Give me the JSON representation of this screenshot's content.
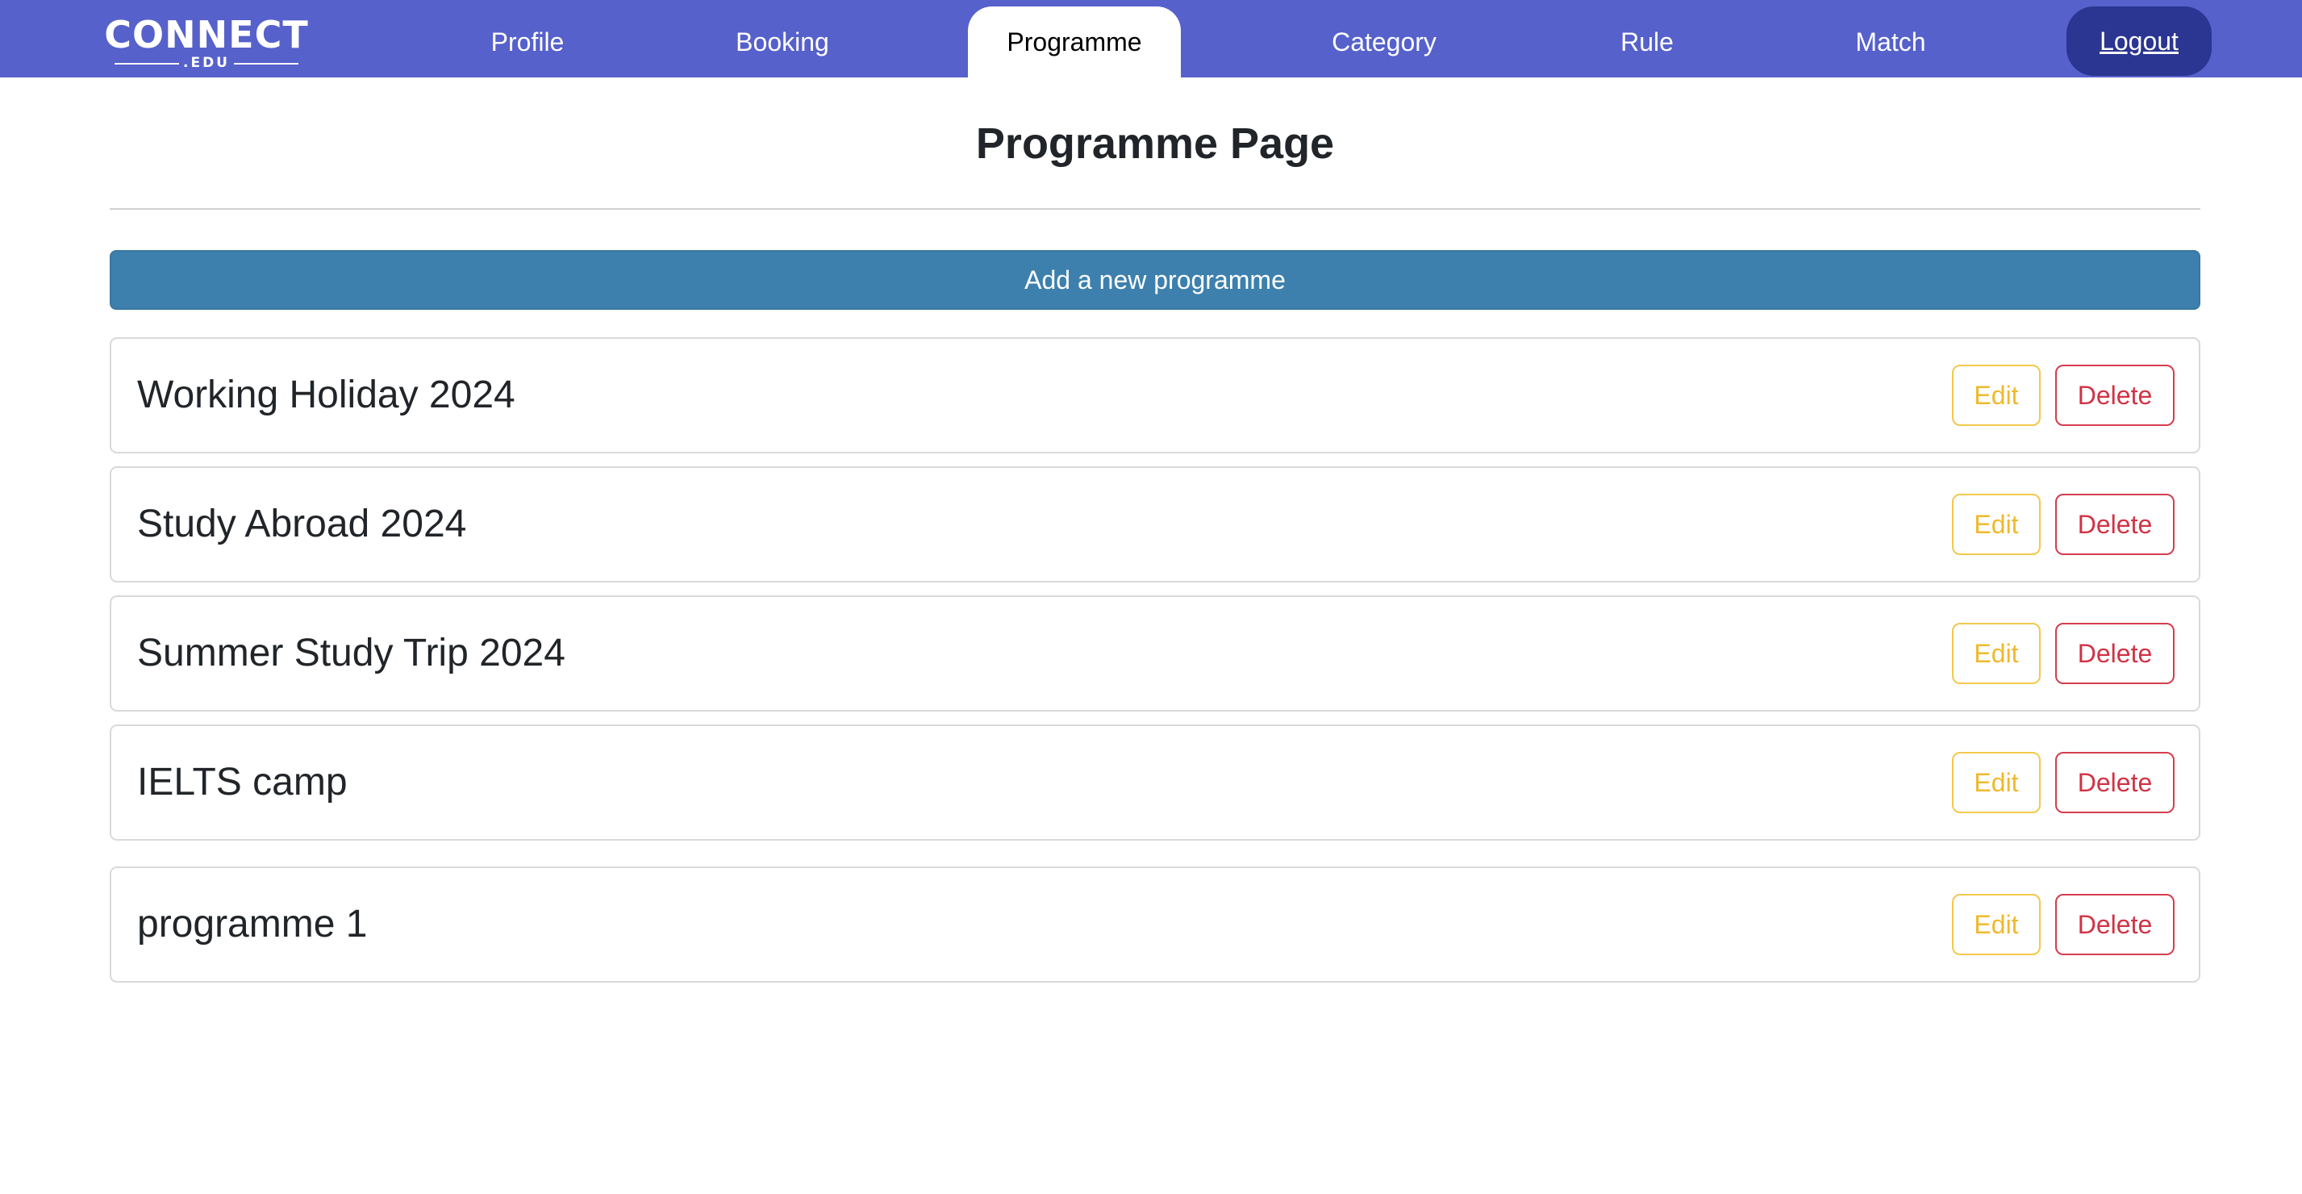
{
  "brand": {
    "name": "CONNECT",
    "suffix": ".EDU"
  },
  "nav": {
    "items": [
      {
        "label": "Profile"
      },
      {
        "label": "Booking"
      },
      {
        "label": "Programme"
      },
      {
        "label": "Category"
      },
      {
        "label": "Rule"
      },
      {
        "label": "Match"
      }
    ],
    "active": "Programme",
    "logout_label": "Logout"
  },
  "page": {
    "title": "Programme Page",
    "add_button_label": "Add a new programme"
  },
  "programmes": [
    {
      "name": "Working Holiday 2024",
      "edit_label": "Edit",
      "delete_label": "Delete"
    },
    {
      "name": "Study Abroad 2024",
      "edit_label": "Edit",
      "delete_label": "Delete"
    },
    {
      "name": "Summer Study Trip 2024",
      "edit_label": "Edit",
      "delete_label": "Delete"
    },
    {
      "name": "IELTS camp",
      "edit_label": "Edit",
      "delete_label": "Delete"
    },
    {
      "name": "programme 1",
      "edit_label": "Edit",
      "delete_label": "Delete"
    }
  ],
  "colors": {
    "navbar": "#5661cb",
    "logout_bg": "#2b3592",
    "add_button": "#3d80ad",
    "edit": "#f0b92c",
    "delete": "#d03345"
  }
}
